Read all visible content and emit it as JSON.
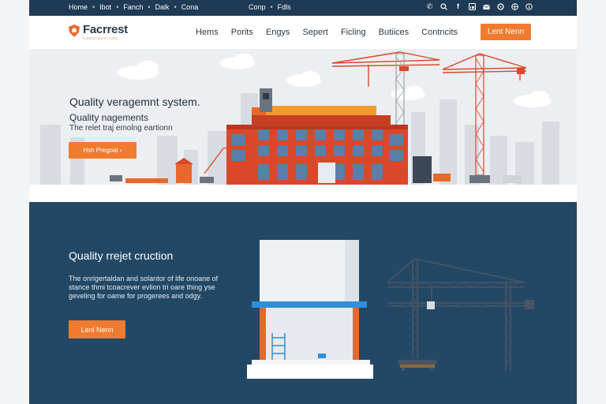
{
  "topbar": {
    "links": [
      "Home",
      "Ibot",
      "Fanch",
      "Dalk",
      "Cona"
    ],
    "links2": [
      "Conp",
      "Fdls"
    ],
    "icons": [
      "phone-icon",
      "search-icon",
      "facebook-icon",
      "linkedin-icon",
      "mail-icon",
      "settings-icon",
      "globe-icon",
      "info-icon"
    ]
  },
  "header": {
    "logo_text": "Facrrest",
    "logo_sub": "CONSTRUCTION",
    "nav": [
      "Hems",
      "Porits",
      "Engys",
      "Sepert",
      "Ficling",
      "Butiices",
      "Contncits"
    ],
    "cta": "Lent Nenn"
  },
  "hero": {
    "title": "Quality veragemnt system.",
    "subtitle": "Quality nagements",
    "desc": "The relet traj emolng eartionn",
    "cta": "Hsh Pregoat ›"
  },
  "section2": {
    "title": "Quality rrejet cruction",
    "desc": "The onrigertaldan and solantor of life onoane of stance thmi tcoacrever evlion tri oare thing yse geveling for oame for progerees and odgy.",
    "cta": "Lenl Nenn"
  },
  "colors": {
    "navy": "#1f3a54",
    "section_blue": "#234865",
    "accent": "#f07b2e",
    "building_red": "#d9482b"
  }
}
